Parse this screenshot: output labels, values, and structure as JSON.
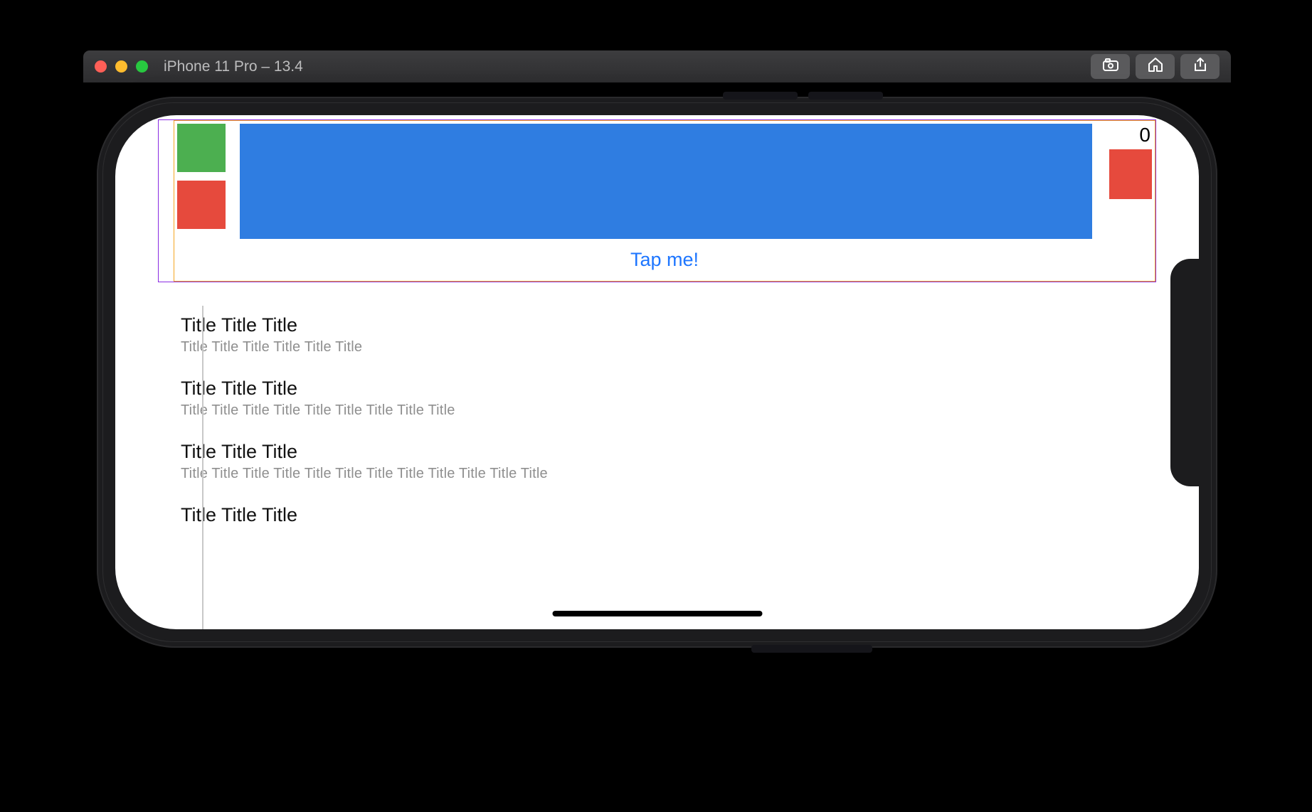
{
  "window": {
    "title": "iPhone 11 Pro – 13.4",
    "buttons": {
      "screenshot": "screenshot",
      "home": "home",
      "share": "share"
    }
  },
  "app": {
    "counter": "0",
    "tap_label": "Tap me!",
    "list": [
      {
        "title": "Title Title Title",
        "subtitle": "Title Title Title  Title Title Title"
      },
      {
        "title": "Title Title Title",
        "subtitle": "Title Title Title  Title Title Title  Title Title Title"
      },
      {
        "title": "Title Title Title",
        "subtitle": "Title Title Title  Title Title Title  Title Title Title  Title Title Title"
      },
      {
        "title": "Title Title Title",
        "subtitle": ""
      }
    ]
  },
  "colors": {
    "blue": "#2f7de1",
    "green": "#4caf50",
    "red": "#e64a3d",
    "link": "#1e76ff",
    "debug_orange": "#f5a623",
    "debug_purple": "#8a2be2"
  }
}
